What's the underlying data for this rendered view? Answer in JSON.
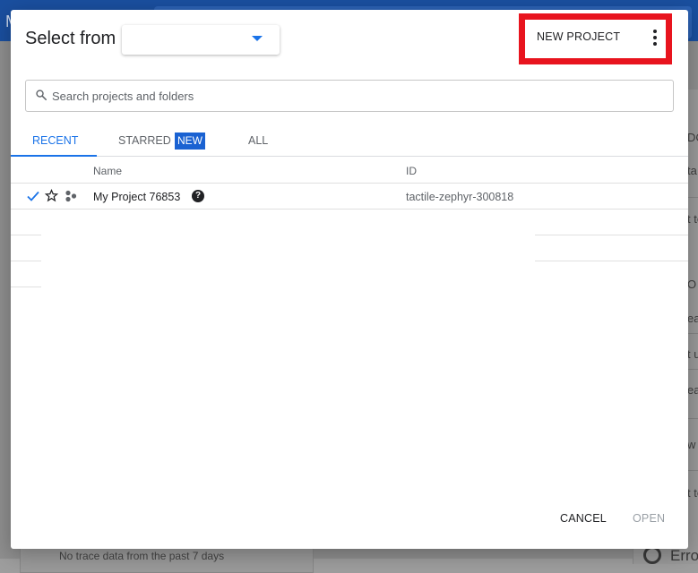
{
  "background": {
    "brand_fragment": "M",
    "right_panel_fragments": [
      "DC",
      "ta",
      "t to",
      "O",
      "eat",
      "t u",
      "eat",
      "w",
      "t to"
    ],
    "footer_text": "No trace data from the past 7 days",
    "error_label": "Erro"
  },
  "dialog": {
    "title": "Select from",
    "org_select_value": "",
    "new_project_label": "NEW PROJECT",
    "search": {
      "placeholder": "Search projects and folders",
      "value": ""
    },
    "tabs": [
      {
        "label": "RECENT",
        "active": true
      },
      {
        "label": "STARRED",
        "badge": "NEW",
        "active": false
      },
      {
        "label": "ALL",
        "active": false
      }
    ],
    "table": {
      "columns": {
        "name": "Name",
        "id": "ID"
      },
      "rows": [
        {
          "name": "My Project 76853",
          "id": "tactile-zephyr-300818",
          "selected": true,
          "starred": false
        }
      ]
    },
    "footer": {
      "cancel_label": "CANCEL",
      "open_label": "OPEN"
    }
  },
  "colors": {
    "accent": "#1a73e8",
    "badge_bg": "#1a62d2",
    "highlight_box": "#e8141e",
    "topbar": "#1a4f9f"
  },
  "icons": [
    "search-icon",
    "chevron-down-icon",
    "more-vert-icon",
    "check-icon",
    "star-outline-icon",
    "organization-icon",
    "help-icon"
  ]
}
